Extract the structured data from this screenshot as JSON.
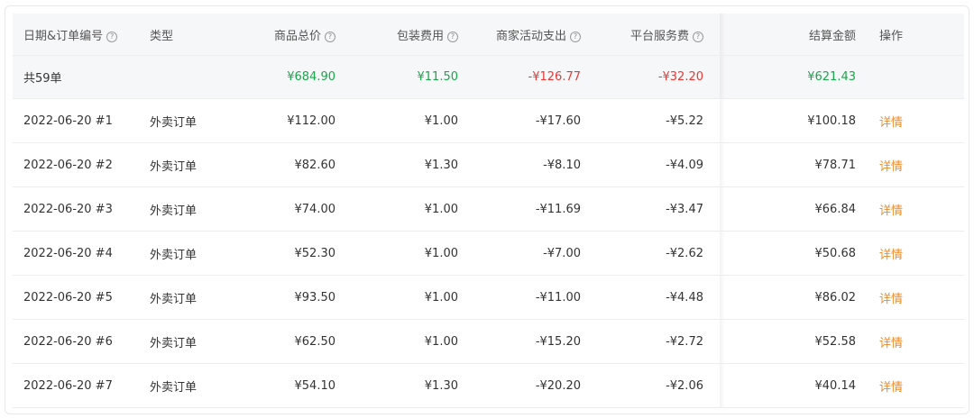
{
  "columns": {
    "date_order": "日期&订单编号",
    "type": "类型",
    "goods_total": "商品总价",
    "packing_fee": "包装费用",
    "merchant_activity": "商家活动支出",
    "platform_fee": "平台服务费",
    "settlement": "结算金额",
    "action": "操作"
  },
  "help_glyph": "?",
  "summary": {
    "label": "共59单",
    "goods_total": "¥684.90",
    "packing_fee": "¥11.50",
    "merchant_activity": "-¥126.77",
    "platform_fee": "-¥32.20",
    "settlement": "¥621.43"
  },
  "rows": [
    {
      "date_order": "2022-06-20 #1",
      "type": "外卖订单",
      "goods_total": "¥112.00",
      "packing_fee": "¥1.00",
      "merchant_activity": "-¥17.60",
      "platform_fee": "-¥5.22",
      "settlement": "¥100.18",
      "action": "详情"
    },
    {
      "date_order": "2022-06-20 #2",
      "type": "外卖订单",
      "goods_total": "¥82.60",
      "packing_fee": "¥1.30",
      "merchant_activity": "-¥8.10",
      "platform_fee": "-¥4.09",
      "settlement": "¥78.71",
      "action": "详情"
    },
    {
      "date_order": "2022-06-20 #3",
      "type": "外卖订单",
      "goods_total": "¥74.00",
      "packing_fee": "¥1.00",
      "merchant_activity": "-¥11.69",
      "platform_fee": "-¥3.47",
      "settlement": "¥66.84",
      "action": "详情"
    },
    {
      "date_order": "2022-06-20 #4",
      "type": "外卖订单",
      "goods_total": "¥52.30",
      "packing_fee": "¥1.00",
      "merchant_activity": "-¥7.00",
      "platform_fee": "-¥2.62",
      "settlement": "¥50.68",
      "action": "详情"
    },
    {
      "date_order": "2022-06-20 #5",
      "type": "外卖订单",
      "goods_total": "¥93.50",
      "packing_fee": "¥1.00",
      "merchant_activity": "-¥11.00",
      "platform_fee": "-¥4.48",
      "settlement": "¥86.02",
      "action": "详情"
    },
    {
      "date_order": "2022-06-20 #6",
      "type": "外卖订单",
      "goods_total": "¥62.50",
      "packing_fee": "¥1.00",
      "merchant_activity": "-¥15.20",
      "platform_fee": "-¥2.72",
      "settlement": "¥52.58",
      "action": "详情"
    },
    {
      "date_order": "2022-06-20 #7",
      "type": "外卖订单",
      "goods_total": "¥54.10",
      "packing_fee": "¥1.30",
      "merchant_activity": "-¥20.20",
      "platform_fee": "-¥2.06",
      "settlement": "¥40.14",
      "action": "详情"
    }
  ],
  "colors": {
    "positive": "#1aa64a",
    "negative": "#e53935",
    "link": "#f08a24",
    "header_bg": "#f6f7f9"
  }
}
